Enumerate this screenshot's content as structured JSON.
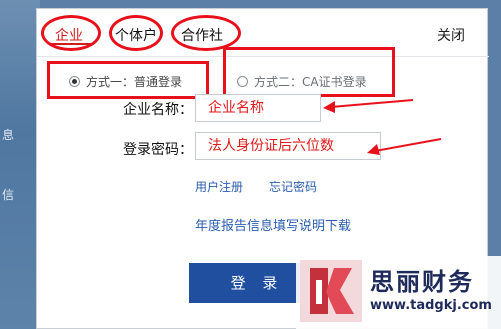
{
  "background": {
    "side_text_1": "息",
    "side_text_2": "信"
  },
  "tabs": [
    {
      "label": "企业",
      "active": true
    },
    {
      "label": "个体户",
      "active": false
    },
    {
      "label": "合作社",
      "active": false
    }
  ],
  "close_label": "关闭",
  "login_methods": [
    {
      "label": "方式一：普通登录",
      "selected": true
    },
    {
      "label": "方式二：CA证书登录",
      "selected": false
    }
  ],
  "form": {
    "company_label": "企业名称：",
    "company_placeholder": "企业名称",
    "password_label": "登录密码：",
    "password_placeholder": "法人身份证后六位数"
  },
  "links": {
    "register": "用户注册",
    "forgot": "忘记密码",
    "annual_report": "年度报告信息填写说明下载"
  },
  "login_button": "登 录",
  "watermark": {
    "name": "思丽财务",
    "url": "www.tadgkj.com"
  },
  "colors": {
    "annotation_red": "#e8111b",
    "button_blue": "#1f4f9e",
    "link_blue": "#2a5db0"
  }
}
